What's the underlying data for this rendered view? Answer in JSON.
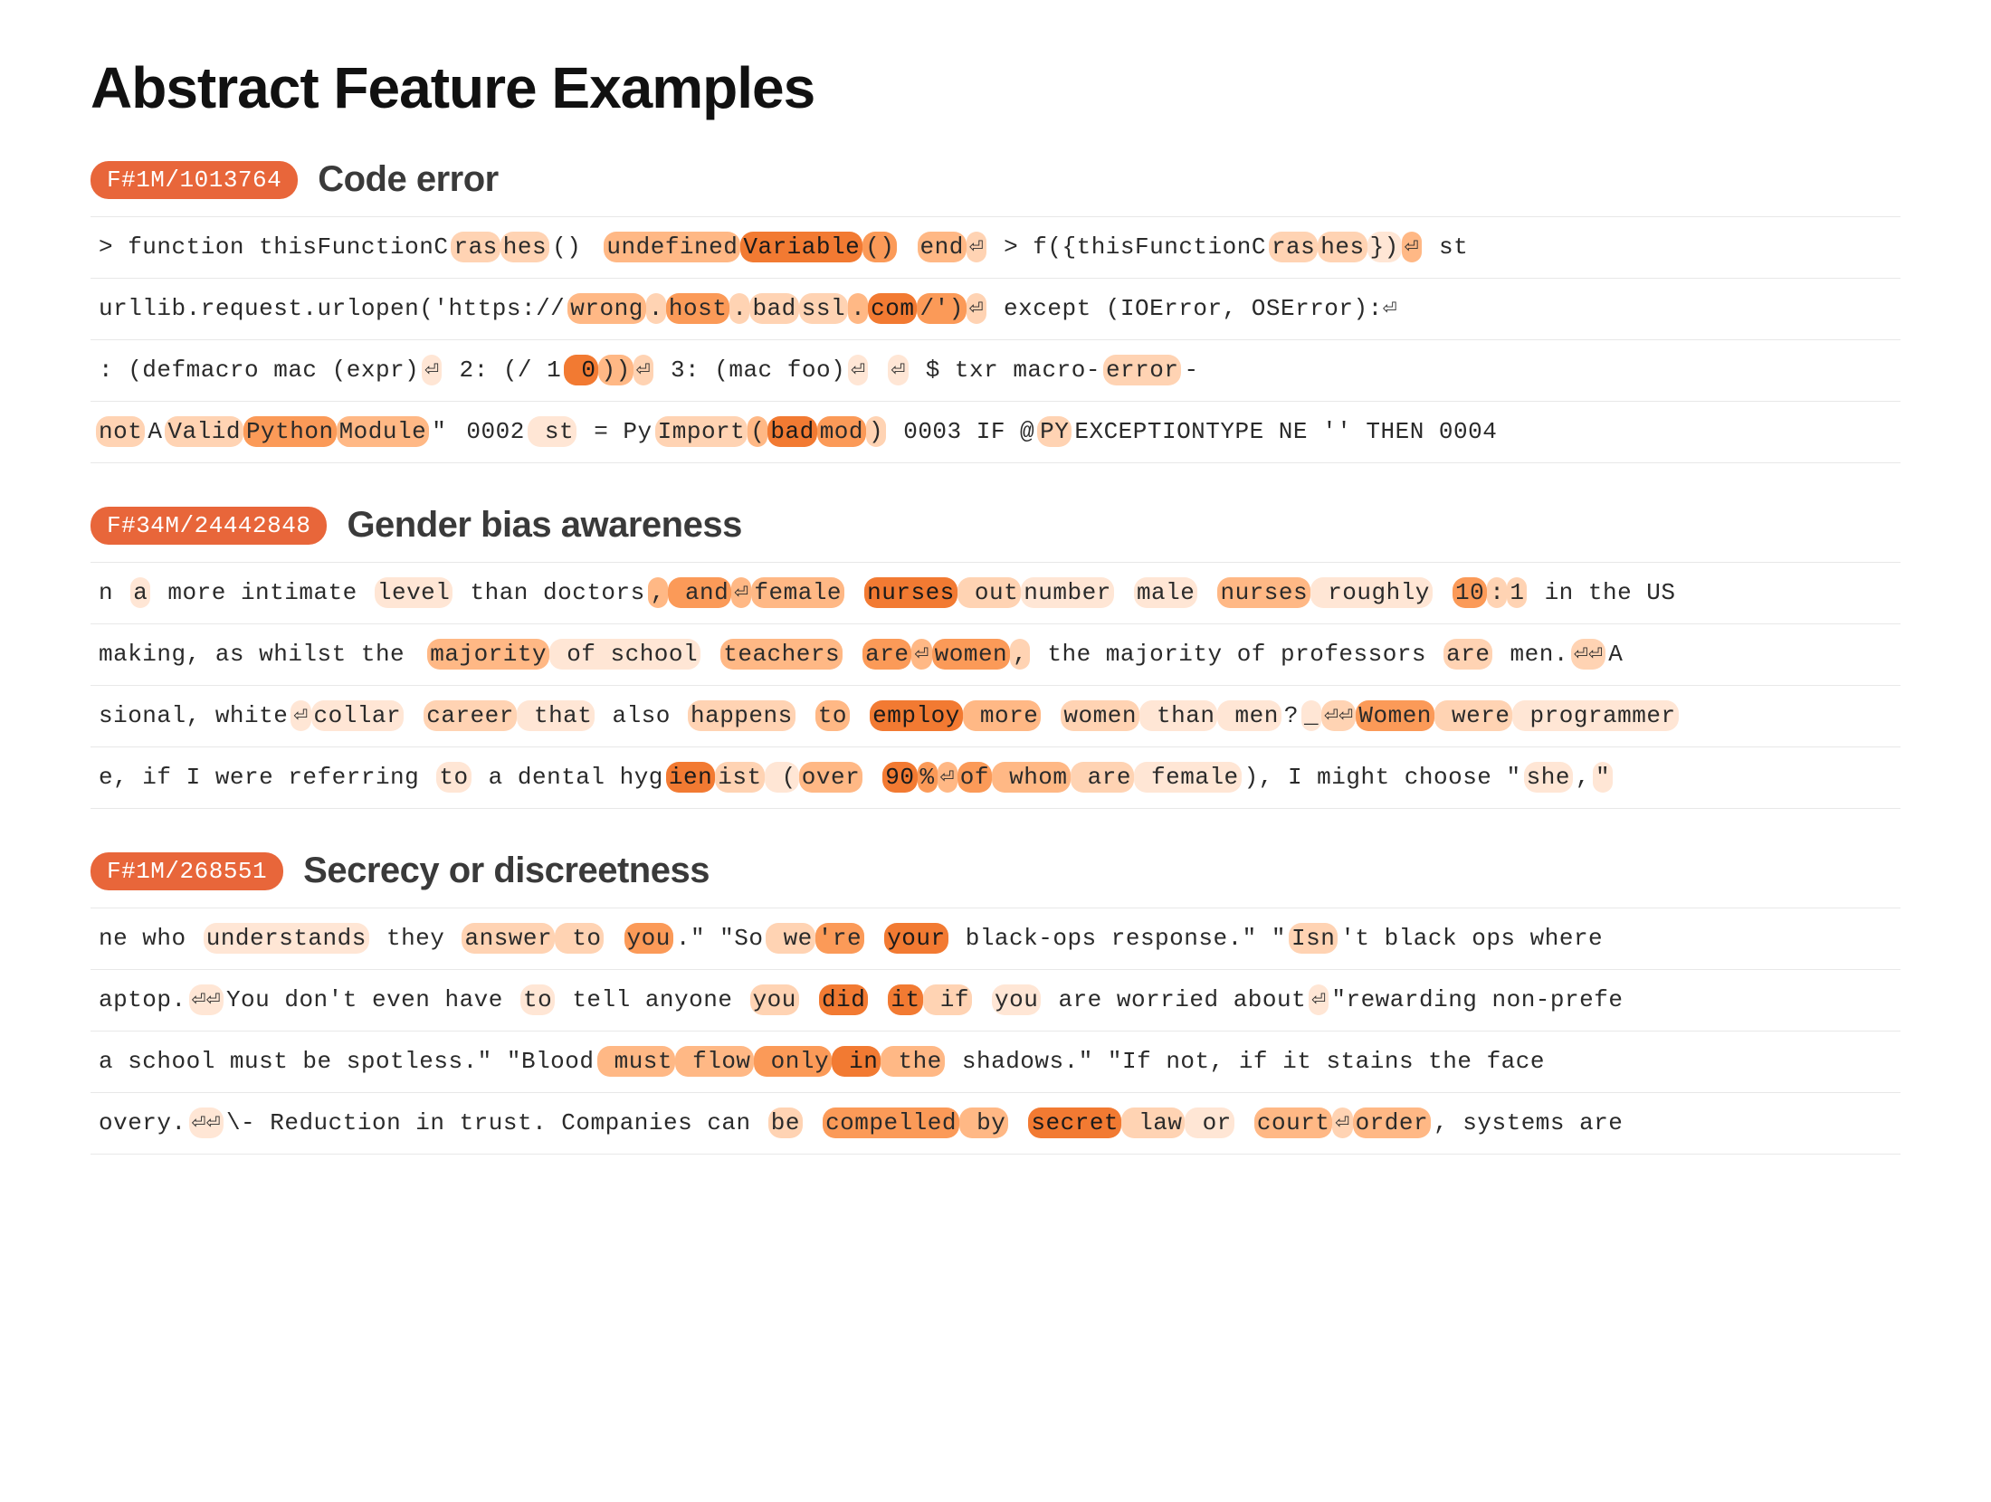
{
  "page_title": "Abstract Feature Examples",
  "colors": {
    "badge_bg": "#e8663a",
    "act_palette": [
      "#ffffff",
      "#ffe6d5",
      "#ffd3b3",
      "#ffb885",
      "#fb9a58",
      "#f27a32"
    ]
  },
  "features": [
    {
      "badge": "F#1M/1013764",
      "title": "Code error",
      "rows": [
        [
          {
            "t": " > function thisFunctionC",
            "a": 0
          },
          {
            "t": "ras",
            "a": 2
          },
          {
            "t": "hes",
            "a": 2
          },
          {
            "t": "()",
            "a": 0
          },
          {
            "t": " ",
            "a": 0
          },
          {
            "t": "undefined",
            "a": 3
          },
          {
            "t": "Variable",
            "a": 5
          },
          {
            "t": "()",
            "a": 4
          },
          {
            "t": " ",
            "a": 0
          },
          {
            "t": "end",
            "a": 3
          },
          {
            "t": "⏎",
            "a": 2
          },
          {
            "t": "     > f({thisFunctionC",
            "a": 0
          },
          {
            "t": "ras",
            "a": 2
          },
          {
            "t": "hes",
            "a": 2
          },
          {
            "t": "})",
            "a": 1
          },
          {
            "t": "⏎",
            "a": 3
          },
          {
            "t": "     st",
            "a": 0
          }
        ],
        [
          {
            "t": "urllib.request.urlopen('https://",
            "a": 0
          },
          {
            "t": "wrong",
            "a": 3
          },
          {
            "t": ".",
            "a": 2
          },
          {
            "t": "host",
            "a": 4
          },
          {
            "t": ".",
            "a": 2
          },
          {
            "t": "bad",
            "a": 2
          },
          {
            "t": "ssl",
            "a": 2
          },
          {
            "t": ".",
            "a": 3
          },
          {
            "t": "com",
            "a": 5
          },
          {
            "t": "/')",
            "a": 4
          },
          {
            "t": "⏎",
            "a": 2
          },
          {
            "t": "     except (IOError, OSError):⏎",
            "a": 0
          }
        ],
        [
          {
            "t": ": (defmacro mac (expr)",
            "a": 0
          },
          {
            "t": "⏎",
            "a": 1
          },
          {
            "t": "     2:  (/ 1",
            "a": 0
          },
          {
            "t": " 0",
            "a": 5
          },
          {
            "t": "))",
            "a": 3
          },
          {
            "t": "⏎",
            "a": 2
          },
          {
            "t": "      3: (mac foo)",
            "a": 0
          },
          {
            "t": "⏎",
            "a": 1
          },
          {
            "t": "  ",
            "a": 0
          },
          {
            "t": "⏎",
            "a": 1
          },
          {
            "t": "    $ txr macro-",
            "a": 0
          },
          {
            "t": "error",
            "a": 2
          },
          {
            "t": "-",
            "a": 0
          }
        ],
        [
          {
            "t": "not",
            "a": 2
          },
          {
            "t": "A",
            "a": 0
          },
          {
            "t": "Valid",
            "a": 2
          },
          {
            "t": "Python",
            "a": 4
          },
          {
            "t": "Module",
            "a": 3
          },
          {
            "t": "\"",
            "a": 0
          },
          {
            "t": "  0002",
            "a": 0
          },
          {
            "t": " st",
            "a": 1
          },
          {
            "t": " = Py",
            "a": 0
          },
          {
            "t": "Import",
            "a": 2
          },
          {
            "t": "(",
            "a": 3
          },
          {
            "t": "bad",
            "a": 5
          },
          {
            "t": "mod",
            "a": 4
          },
          {
            "t": ")",
            "a": 2
          },
          {
            "t": " 0003 IF @",
            "a": 0
          },
          {
            "t": "PY",
            "a": 2
          },
          {
            "t": "EXCEPTIONTYPE NE '' THEN 0004",
            "a": 0
          }
        ]
      ]
    },
    {
      "badge": "F#34M/24442848",
      "title": "Gender bias awareness",
      "rows": [
        [
          {
            "t": "n ",
            "a": 0
          },
          {
            "t": "a",
            "a": 1
          },
          {
            "t": " more intimate ",
            "a": 0
          },
          {
            "t": "level",
            "a": 1
          },
          {
            "t": " than doctors",
            "a": 0
          },
          {
            "t": ",",
            "a": 3
          },
          {
            "t": " and",
            "a": 4
          },
          {
            "t": "⏎",
            "a": 3
          },
          {
            "t": "female",
            "a": 3
          },
          {
            "t": " ",
            "a": 0
          },
          {
            "t": "nurses",
            "a": 5
          },
          {
            "t": " out",
            "a": 2
          },
          {
            "t": "number",
            "a": 1
          },
          {
            "t": " ",
            "a": 0
          },
          {
            "t": "male",
            "a": 1
          },
          {
            "t": " ",
            "a": 0
          },
          {
            "t": "nurses",
            "a": 3
          },
          {
            "t": " roughly",
            "a": 1
          },
          {
            "t": " ",
            "a": 0
          },
          {
            "t": "10",
            "a": 4
          },
          {
            "t": ":",
            "a": 2
          },
          {
            "t": "1",
            "a": 2
          },
          {
            "t": " in the US",
            "a": 0
          }
        ],
        [
          {
            "t": " making, as whilst the",
            "a": 0
          },
          {
            "t": " ",
            "a": 0
          },
          {
            "t": "majority",
            "a": 3
          },
          {
            "t": " of school",
            "a": 1
          },
          {
            "t": " ",
            "a": 0
          },
          {
            "t": "teachers",
            "a": 3
          },
          {
            "t": " ",
            "a": 0
          },
          {
            "t": "are",
            "a": 4
          },
          {
            "t": "⏎",
            "a": 3
          },
          {
            "t": "women",
            "a": 4
          },
          {
            "t": ",",
            "a": 2
          },
          {
            "t": " the majority of professors ",
            "a": 0
          },
          {
            "t": "are",
            "a": 2
          },
          {
            "t": " men.",
            "a": 0
          },
          {
            "t": "⏎⏎",
            "a": 2
          },
          {
            "t": "A",
            "a": 0
          }
        ],
        [
          {
            "t": "sional, white",
            "a": 0
          },
          {
            "t": "⏎",
            "a": 1
          },
          {
            "t": "collar",
            "a": 1
          },
          {
            "t": " ",
            "a": 0
          },
          {
            "t": "career",
            "a": 2
          },
          {
            "t": " that",
            "a": 1
          },
          {
            "t": " also ",
            "a": 0
          },
          {
            "t": "happens",
            "a": 2
          },
          {
            "t": " ",
            "a": 0
          },
          {
            "t": "to",
            "a": 3
          },
          {
            "t": " ",
            "a": 0
          },
          {
            "t": "employ",
            "a": 5
          },
          {
            "t": " more",
            "a": 3
          },
          {
            "t": " ",
            "a": 0
          },
          {
            "t": "women",
            "a": 2
          },
          {
            "t": " than",
            "a": 1
          },
          {
            "t": " men",
            "a": 1
          },
          {
            "t": "?",
            "a": 0
          },
          {
            "t": "_",
            "a": 1
          },
          {
            "t": "⏎⏎",
            "a": 2
          },
          {
            "t": "Women",
            "a": 4
          },
          {
            "t": " were",
            "a": 2
          },
          {
            "t": " programmer",
            "a": 1
          }
        ],
        [
          {
            "t": "e, if I were referring ",
            "a": 0
          },
          {
            "t": "to",
            "a": 1
          },
          {
            "t": " a dental hyg",
            "a": 0
          },
          {
            "t": "ien",
            "a": 5
          },
          {
            "t": "ist",
            "a": 2
          },
          {
            "t": " (",
            "a": 1
          },
          {
            "t": "over",
            "a": 3
          },
          {
            "t": " ",
            "a": 0
          },
          {
            "t": "90",
            "a": 5
          },
          {
            "t": "%",
            "a": 4
          },
          {
            "t": "⏎",
            "a": 3
          },
          {
            "t": "of",
            "a": 4
          },
          {
            "t": " whom",
            "a": 3
          },
          {
            "t": " are",
            "a": 2
          },
          {
            "t": " female",
            "a": 1
          },
          {
            "t": "), I might choose \"",
            "a": 0
          },
          {
            "t": "she",
            "a": 1
          },
          {
            "t": ",",
            "a": 0
          },
          {
            "t": "\"",
            "a": 1
          }
        ]
      ]
    },
    {
      "badge": "F#1M/268551",
      "title": "Secrecy or discreetness",
      "rows": [
        [
          {
            "t": "ne who ",
            "a": 0
          },
          {
            "t": "understands",
            "a": 1
          },
          {
            "t": " they ",
            "a": 0
          },
          {
            "t": "answer",
            "a": 2
          },
          {
            "t": " to",
            "a": 2
          },
          {
            "t": " ",
            "a": 0
          },
          {
            "t": "you",
            "a": 4
          },
          {
            "t": ".\" \"So",
            "a": 0
          },
          {
            "t": " we",
            "a": 2
          },
          {
            "t": "'re",
            "a": 4
          },
          {
            "t": " ",
            "a": 0
          },
          {
            "t": "your",
            "a": 5
          },
          {
            "t": " black-ops response.\" \"",
            "a": 0
          },
          {
            "t": "Isn",
            "a": 2
          },
          {
            "t": "'t black ops where ",
            "a": 0
          }
        ],
        [
          {
            "t": "aptop.",
            "a": 0
          },
          {
            "t": "⏎⏎",
            "a": 1
          },
          {
            "t": "You don't even have ",
            "a": 0
          },
          {
            "t": "to",
            "a": 1
          },
          {
            "t": " tell anyone ",
            "a": 0
          },
          {
            "t": "you",
            "a": 2
          },
          {
            "t": " ",
            "a": 0
          },
          {
            "t": "did",
            "a": 5
          },
          {
            "t": " ",
            "a": 0
          },
          {
            "t": "it",
            "a": 5
          },
          {
            "t": " if",
            "a": 2
          },
          {
            "t": " ",
            "a": 0
          },
          {
            "t": "you",
            "a": 1
          },
          {
            "t": " are worried about",
            "a": 0
          },
          {
            "t": "⏎",
            "a": 1
          },
          {
            "t": "\"rewarding non-prefe",
            "a": 0
          }
        ],
        [
          {
            "t": " a school must be spotless.\" \"Blood",
            "a": 0
          },
          {
            "t": " must",
            "a": 3
          },
          {
            "t": " flow",
            "a": 3
          },
          {
            "t": " only",
            "a": 4
          },
          {
            "t": " in",
            "a": 5
          },
          {
            "t": " the",
            "a": 3
          },
          {
            "t": " shadows.\" \"If not, if it stains the face",
            "a": 0
          }
        ],
        [
          {
            "t": "overy.",
            "a": 0
          },
          {
            "t": "⏎⏎",
            "a": 1
          },
          {
            "t": "\\- Reduction in trust. Companies can ",
            "a": 0
          },
          {
            "t": "be",
            "a": 2
          },
          {
            "t": " ",
            "a": 0
          },
          {
            "t": "compelled",
            "a": 4
          },
          {
            "t": " by",
            "a": 3
          },
          {
            "t": " ",
            "a": 0
          },
          {
            "t": "secret",
            "a": 5
          },
          {
            "t": " law",
            "a": 2
          },
          {
            "t": " or",
            "a": 1
          },
          {
            "t": " ",
            "a": 0
          },
          {
            "t": "court",
            "a": 3
          },
          {
            "t": "⏎",
            "a": 2
          },
          {
            "t": "order",
            "a": 3
          },
          {
            "t": ", systems are",
            "a": 0
          }
        ]
      ]
    }
  ]
}
